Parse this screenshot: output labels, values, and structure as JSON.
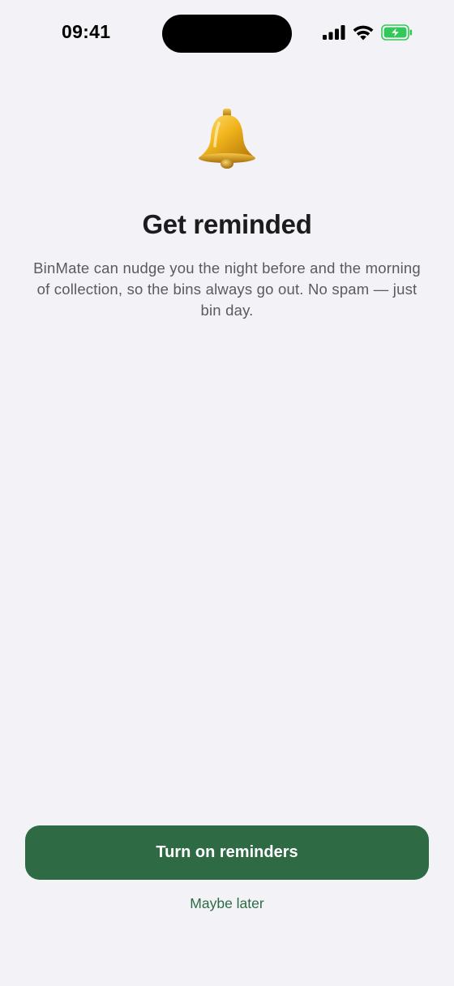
{
  "status_bar": {
    "time": "09:41",
    "icons": [
      "cellular-signal-icon",
      "wifi-icon",
      "battery-charging-icon"
    ]
  },
  "onboarding": {
    "icon": "bell-icon",
    "title": "Get reminded",
    "body": "BinMate can nudge you the night before and the morning of collection, so the bins always go out. No spam — just bin day."
  },
  "actions": {
    "primary_label": "Turn on reminders",
    "secondary_label": "Maybe later"
  },
  "colors": {
    "background": "#f2f2f7",
    "accent": "#2e6b44",
    "battery": "#34c759"
  }
}
